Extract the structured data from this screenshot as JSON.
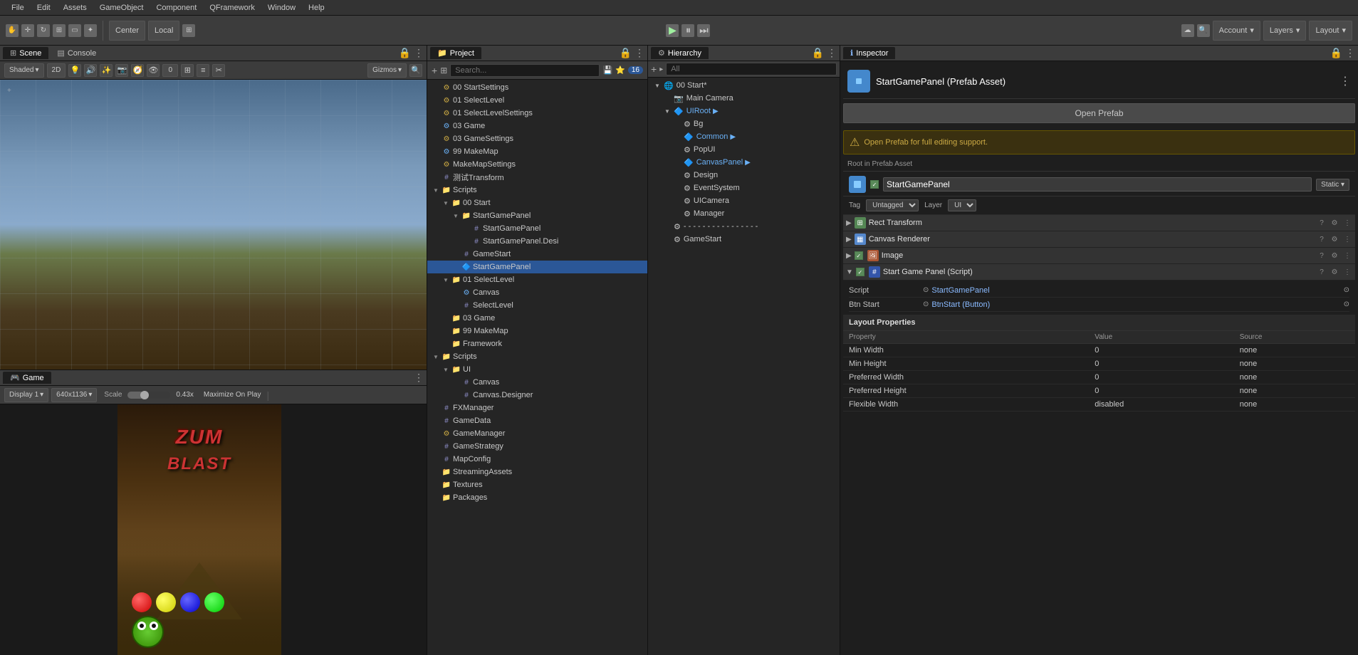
{
  "menu": {
    "items": [
      "File",
      "Edit",
      "Assets",
      "GameObject",
      "Component",
      "QFramework",
      "Window",
      "Help"
    ]
  },
  "toolbar": {
    "transform_tools": [
      "hand",
      "move",
      "rotate",
      "scale",
      "rect",
      "multi"
    ],
    "center_label": "Center",
    "local_label": "Local",
    "grid_label": "⊞",
    "play_label": "▶",
    "pause_label": "⏸",
    "step_label": "⏭",
    "account_label": "Account",
    "layers_label": "Layers",
    "layout_label": "Layout"
  },
  "scene_panel": {
    "tab1": "Scene",
    "tab2": "Console",
    "shading": "Shaded",
    "mode_2d": "2D",
    "gizmos": "Gizmos"
  },
  "game_panel": {
    "tab": "Game",
    "display": "Display 1",
    "resolution": "640x1136",
    "scale_label": "Scale",
    "scale_value": "0.43x",
    "maximize": "Maximize On Play",
    "title_line1": "ZUM",
    "title_line2": "BLAST"
  },
  "project_panel": {
    "tab": "Project",
    "search_placeholder": "Search...",
    "badge": "16",
    "items": [
      {
        "id": "00StartSettings",
        "label": "00 StartSettings",
        "type": "gear",
        "indent": 0
      },
      {
        "id": "01SelectLevel",
        "label": "01 SelectLevel",
        "type": "gear",
        "indent": 0
      },
      {
        "id": "01SelectLevelSettings",
        "label": "01 SelectLevelSettings",
        "type": "gear",
        "indent": 0
      },
      {
        "id": "03Game",
        "label": "03 Game",
        "type": "gameobj",
        "indent": 0
      },
      {
        "id": "03GameSettings",
        "label": "03 GameSettings",
        "type": "gear",
        "indent": 0
      },
      {
        "id": "99MakeMap",
        "label": "99 MakeMap",
        "type": "gameobj",
        "indent": 0
      },
      {
        "id": "MakeMapSettings",
        "label": "MakeMapSettings",
        "type": "gear",
        "indent": 0
      },
      {
        "id": "TestTransform",
        "label": "测试Transform",
        "type": "cs",
        "indent": 0
      },
      {
        "id": "Scripts",
        "label": "Scripts",
        "type": "folder",
        "indent": 0,
        "expanded": true
      },
      {
        "id": "00Start",
        "label": "00 Start",
        "type": "folder",
        "indent": 1,
        "expanded": true
      },
      {
        "id": "StartGamePanel",
        "label": "StartGamePanel",
        "type": "folder",
        "indent": 2,
        "expanded": true
      },
      {
        "id": "StartGamePanelCS",
        "label": "StartGamePanel",
        "type": "cs",
        "indent": 3
      },
      {
        "id": "StartGamePanelDesi",
        "label": "StartGamePanel.Desi",
        "type": "cs",
        "indent": 3
      },
      {
        "id": "GameStart",
        "label": "GameStart",
        "type": "cs",
        "indent": 2
      },
      {
        "id": "StartGamePanelSelected",
        "label": "StartGamePanel",
        "type": "prefab",
        "indent": 2,
        "selected": true
      },
      {
        "id": "01SelectLevelFolder",
        "label": "01 SelectLevel",
        "type": "folder",
        "indent": 1,
        "expanded": true
      },
      {
        "id": "Canvas",
        "label": "Canvas",
        "type": "gameobj",
        "indent": 2
      },
      {
        "id": "SelectLevel",
        "label": "SelectLevel",
        "type": "cs",
        "indent": 2
      },
      {
        "id": "03GameFolder",
        "label": "03 Game",
        "type": "folder",
        "indent": 1
      },
      {
        "id": "99MakeMapFolder",
        "label": "99 MakeMap",
        "type": "folder",
        "indent": 1
      },
      {
        "id": "Framework",
        "label": "Framework",
        "type": "folder",
        "indent": 1
      },
      {
        "id": "ScriptsUI",
        "label": "Scripts",
        "type": "folder",
        "indent": 0,
        "expanded": true
      },
      {
        "id": "UIFolder",
        "label": "UI",
        "type": "folder",
        "indent": 1,
        "expanded": true
      },
      {
        "id": "CanvasCS",
        "label": "Canvas",
        "type": "cs",
        "indent": 2
      },
      {
        "id": "CanvasDesignerCS",
        "label": "Canvas.Designer",
        "type": "cs",
        "indent": 2
      },
      {
        "id": "FXManager",
        "label": "FXManager",
        "type": "cs",
        "indent": 0
      },
      {
        "id": "GameData",
        "label": "GameData",
        "type": "cs",
        "indent": 0
      },
      {
        "id": "GameManager",
        "label": "GameManager",
        "type": "gear",
        "indent": 0
      },
      {
        "id": "GameStrategy",
        "label": "GameStrategy",
        "type": "cs",
        "indent": 0
      },
      {
        "id": "MapConfig",
        "label": "MapConfig",
        "type": "cs",
        "indent": 0
      },
      {
        "id": "StreamingAssets",
        "label": "StreamingAssets",
        "type": "folder",
        "indent": 0
      },
      {
        "id": "Textures",
        "label": "Textures",
        "type": "folder",
        "indent": 0
      },
      {
        "id": "Packages",
        "label": "Packages",
        "type": "folder",
        "indent": 0
      }
    ]
  },
  "hierarchy_panel": {
    "tab": "Hierarchy",
    "search_placeholder": "All",
    "items": [
      {
        "label": "00 Start*",
        "type": "scene",
        "indent": 0,
        "expanded": true
      },
      {
        "label": "Main Camera",
        "type": "camera",
        "indent": 1
      },
      {
        "label": "UIRoot",
        "type": "prefab",
        "indent": 1,
        "expanded": true
      },
      {
        "label": "Bg",
        "type": "gameobj",
        "indent": 2
      },
      {
        "label": "Common",
        "type": "prefab",
        "indent": 2
      },
      {
        "label": "PopUI",
        "type": "gameobj",
        "indent": 2
      },
      {
        "label": "CanvasPanel",
        "type": "prefab",
        "indent": 2
      },
      {
        "label": "Design",
        "type": "gameobj",
        "indent": 2
      },
      {
        "label": "EventSystem",
        "type": "gameobj",
        "indent": 2
      },
      {
        "label": "UICamera",
        "type": "gameobj",
        "indent": 2
      },
      {
        "label": "Manager",
        "type": "gameobj",
        "indent": 2
      },
      {
        "label": "- - - - - - - - - - - - - - - -",
        "type": "separator_text",
        "indent": 1
      },
      {
        "label": "GameStart",
        "type": "gameobj",
        "indent": 1
      }
    ]
  },
  "inspector_panel": {
    "tab": "Inspector",
    "header_title": "StartGamePanel (Prefab Asset)",
    "header_more": "⋮",
    "open_prefab_btn": "Open Prefab",
    "warning_text": "Open Prefab for full editing support.",
    "section_label": "Root in Prefab Asset",
    "object_name": "StartGamePanel",
    "static_label": "Static",
    "tag_label": "Tag",
    "tag_value": "Untagged",
    "layer_label": "Layer",
    "layer_value": "UI",
    "components": [
      {
        "id": "rect_transform",
        "name": "Rect Transform",
        "icon": "⊞",
        "icon_class": "comp-icon-rect",
        "enabled": false
      },
      {
        "id": "canvas_renderer",
        "name": "Canvas Renderer",
        "icon": "▦",
        "icon_class": "comp-icon-canvas",
        "enabled": false
      },
      {
        "id": "image",
        "name": "Image",
        "icon": "🖼",
        "icon_class": "comp-icon-image",
        "enabled": true
      },
      {
        "id": "start_game_panel",
        "name": "Start Game Panel (Script)",
        "icon": "#",
        "icon_class": "comp-icon-script",
        "enabled": true
      }
    ],
    "script_label": "Script",
    "script_value": "StartGamePanel",
    "btn_start_label": "Btn Start",
    "btn_start_value": "BtnStart (Button)",
    "layout_props_header": "Layout Properties",
    "layout_columns": [
      "Property",
      "Value",
      "Source"
    ],
    "layout_rows": [
      {
        "property": "Min Width",
        "value": "0",
        "source": "none"
      },
      {
        "property": "Min Height",
        "value": "0",
        "source": "none"
      },
      {
        "property": "Preferred Width",
        "value": "0",
        "source": "none"
      },
      {
        "property": "Preferred Height",
        "value": "0",
        "source": "none"
      },
      {
        "property": "Flexible Width",
        "value": "disabled",
        "source": "none"
      }
    ]
  }
}
